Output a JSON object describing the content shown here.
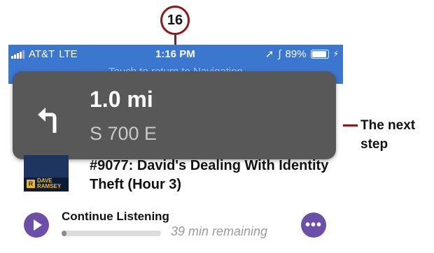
{
  "callout": {
    "number": "16",
    "annotation": "The next step"
  },
  "status_bar": {
    "carrier": "AT&T",
    "network": "LTE",
    "time": "1:16 PM",
    "battery": "89%"
  },
  "banner": {
    "text": "Touch to return to Navigation"
  },
  "navigation": {
    "distance": "1.0 mi",
    "street": "S 700 E",
    "icon": "turn-left-icon"
  },
  "podcast": {
    "artwork_label": "DAVE RAMSEY",
    "episode_title": "#9077: David's Dealing With Identity Theft (Hour 3)",
    "continue_label": "Continue Listening",
    "progress": 0.05,
    "remaining": "39 min remaining"
  },
  "colors": {
    "accent": "#6b4fa8",
    "status_bar": "#3b76cf",
    "nav_card": "#585858",
    "callout": "#8b1a1a"
  }
}
